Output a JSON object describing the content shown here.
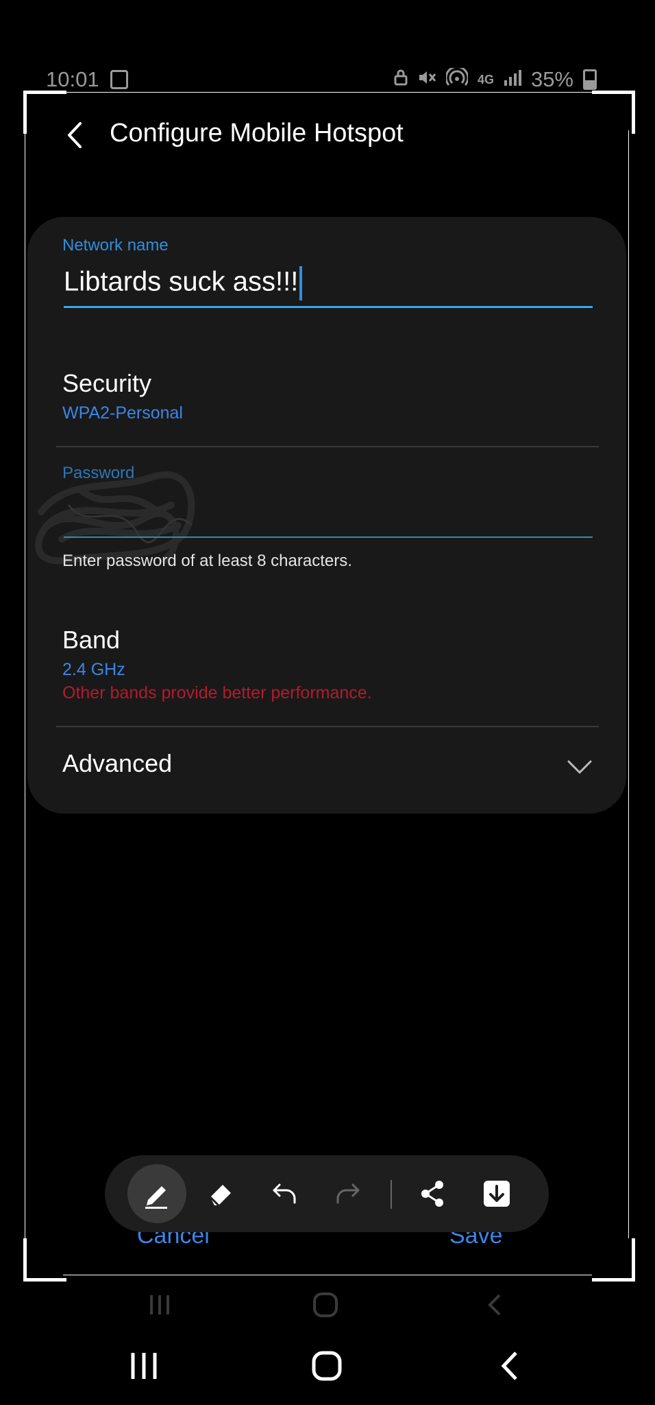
{
  "status_bar": {
    "time": "10:01",
    "battery": "35%",
    "network": "4G"
  },
  "header": {
    "title": "Configure Mobile Hotspot",
    "back_icon": "chevron-left-icon"
  },
  "network_name": {
    "label": "Network name",
    "value": "Libtards suck ass!!!"
  },
  "security": {
    "title": "Security",
    "value": "WPA2-Personal"
  },
  "password": {
    "label": "Password",
    "hint": "Enter password of at least 8 characters."
  },
  "band": {
    "title": "Band",
    "value": "2.4 GHz",
    "warning": "Other bands provide better performance."
  },
  "advanced": {
    "title": "Advanced",
    "icon": "chevron-down-icon"
  },
  "actions": {
    "cancel": "Cancel",
    "save": "Save"
  },
  "toolbar": {
    "tools": [
      "pen-icon",
      "eraser-icon",
      "undo-icon",
      "redo-icon",
      "share-icon",
      "download-icon"
    ]
  },
  "colors": {
    "accent_blue": "#3b86e8",
    "warning_red": "#b01c2e",
    "card_bg": "#191919"
  }
}
